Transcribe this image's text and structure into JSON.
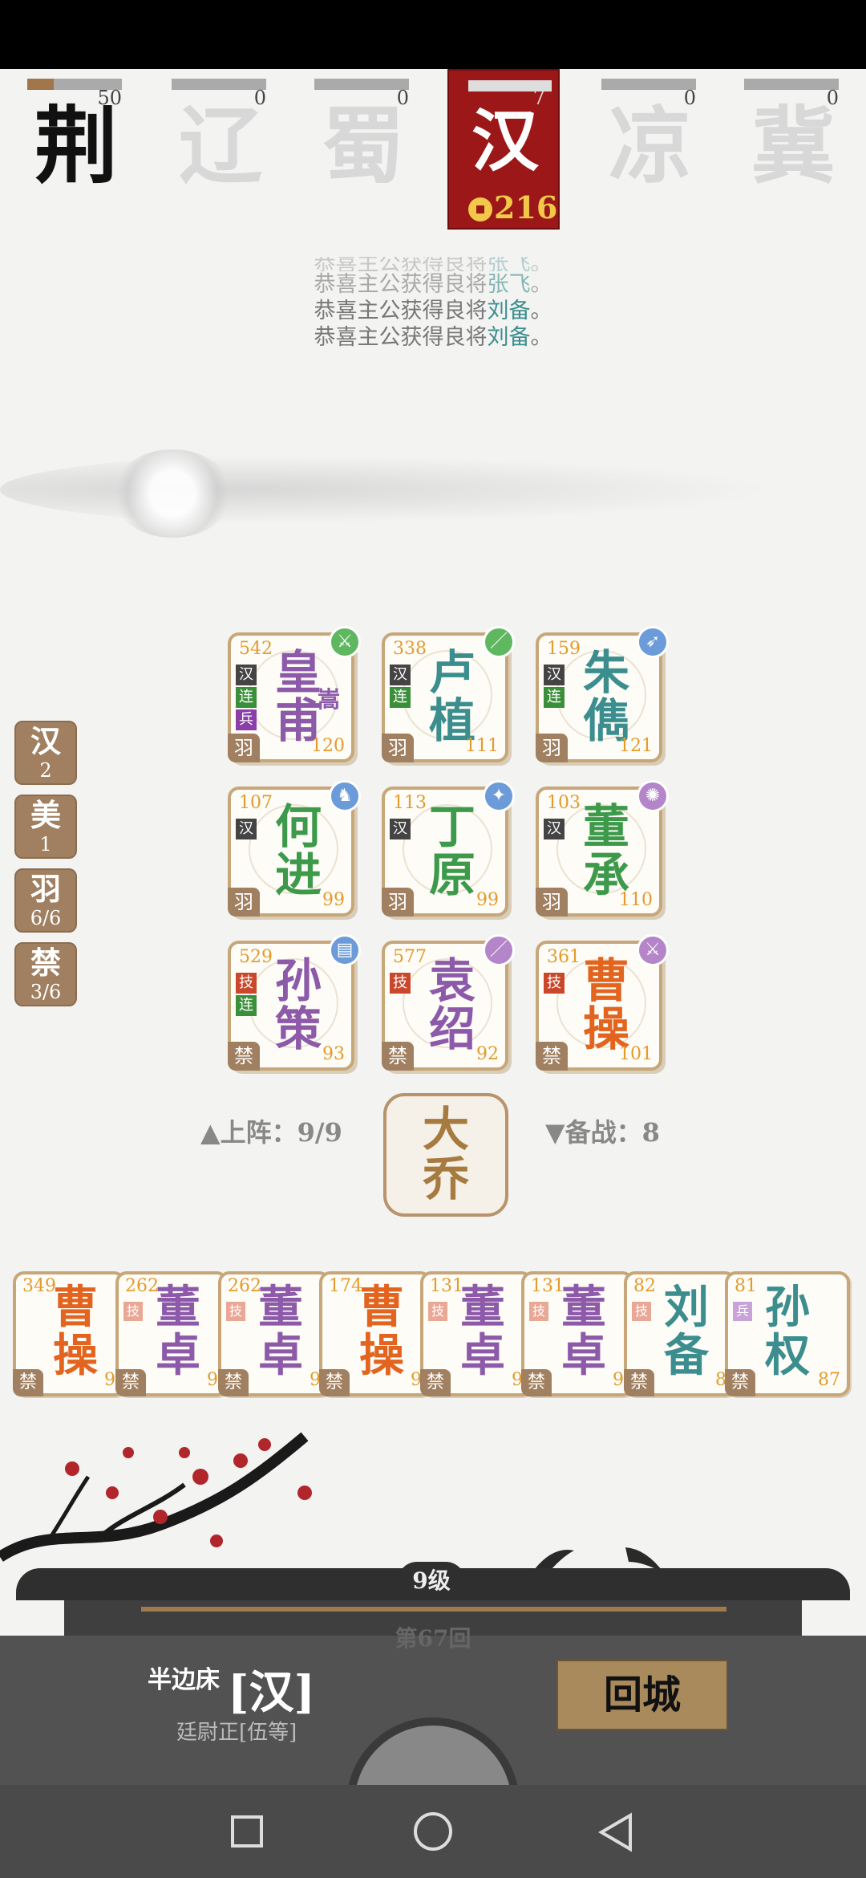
{
  "factions": [
    {
      "name": "荆",
      "count": "50",
      "progress": 0.28,
      "key": "jing"
    },
    {
      "name": "辽",
      "count": "0",
      "progress": 0,
      "key": "liao"
    },
    {
      "name": "蜀",
      "count": "0",
      "progress": 0,
      "key": "shu"
    },
    {
      "name": "汉",
      "count": "7",
      "progress": 0.05,
      "key": "han",
      "coins": "216"
    },
    {
      "name": "凉",
      "count": "0",
      "progress": 0,
      "key": "liang"
    },
    {
      "name": "冀",
      "count": "0",
      "progress": 0,
      "key": "ji"
    }
  ],
  "messages": [
    {
      "prefix": "恭喜主公获得良将",
      "hero": "张飞",
      "suffix": "。"
    },
    {
      "prefix": "恭喜主公获得良将",
      "hero": "张飞",
      "suffix": "。"
    },
    {
      "prefix": "恭喜主公获得良将",
      "hero": "刘备",
      "suffix": "。"
    },
    {
      "prefix": "恭喜主公获得良将",
      "hero": "刘备",
      "suffix": "。"
    }
  ],
  "side_tags": [
    {
      "t": "汉",
      "v": "2"
    },
    {
      "t": "美",
      "v": "1"
    },
    {
      "t": "羽",
      "v": "6/6"
    },
    {
      "t": "禁",
      "v": "3/6"
    }
  ],
  "board": [
    {
      "n1": "皇",
      "n2": "甫",
      "sub": "嵩",
      "top": "542",
      "br": "120",
      "corner": "羽",
      "tags": [
        "汉",
        "连",
        "兵"
      ],
      "badge": "sword",
      "color": "purple"
    },
    {
      "n1": "卢",
      "n2": "植",
      "top": "338",
      "br": "111",
      "corner": "羽",
      "tags": [
        "汉",
        "连"
      ],
      "badge": "spear",
      "color": "teal"
    },
    {
      "n1": "朱",
      "n2": "儁",
      "top": "159",
      "br": "121",
      "corner": "羽",
      "tags": [
        "汉",
        "连"
      ],
      "badge": "bow",
      "color": "teal"
    },
    {
      "n1": "何",
      "n2": "进",
      "top": "107",
      "br": "99",
      "corner": "羽",
      "tags": [
        "汉"
      ],
      "badge": "horse",
      "color": "green"
    },
    {
      "n1": "丁",
      "n2": "原",
      "top": "113",
      "br": "99",
      "corner": "羽",
      "tags": [
        "汉"
      ],
      "badge": "wand",
      "color": "green"
    },
    {
      "n1": "董",
      "n2": "承",
      "top": "103",
      "br": "110",
      "corner": "羽",
      "tags": [
        "汉"
      ],
      "badge": "beast",
      "color": "green"
    },
    {
      "n1": "孙",
      "n2": "策",
      "top": "529",
      "br": "93",
      "corner": "禁",
      "tags": [
        "技",
        "连"
      ],
      "badge": "book",
      "color": "purple"
    },
    {
      "n1": "袁",
      "n2": "绍",
      "top": "577",
      "br": "92",
      "corner": "禁",
      "tags": [
        "技"
      ],
      "badge": "spear",
      "color": "purple"
    },
    {
      "n1": "曹",
      "n2": "操",
      "top": "361",
      "br": "101",
      "corner": "禁",
      "tags": [
        "技"
      ],
      "badge": "sword",
      "color": "orange"
    }
  ],
  "formation_label": "▲上阵：9/9",
  "reserve_label": "▼备战：8",
  "center_hero": {
    "n1": "大",
    "n2": "乔"
  },
  "bench": [
    {
      "n1": "曹",
      "n2": "操",
      "top": "349",
      "br": "9",
      "corner": "禁",
      "tag": "",
      "color": "orange"
    },
    {
      "n1": "董",
      "n2": "卓",
      "top": "262",
      "br": "9",
      "corner": "禁",
      "tag": "技",
      "color": "purple"
    },
    {
      "n1": "董",
      "n2": "卓",
      "top": "262",
      "br": "9",
      "corner": "禁",
      "tag": "技",
      "color": "purple"
    },
    {
      "n1": "曹",
      "n2": "操",
      "top": "174",
      "br": "9",
      "corner": "禁",
      "tag": "",
      "color": "orange"
    },
    {
      "n1": "董",
      "n2": "卓",
      "top": "131",
      "br": "9",
      "corner": "禁",
      "tag": "技",
      "color": "purple"
    },
    {
      "n1": "董",
      "n2": "卓",
      "top": "131",
      "br": "9",
      "corner": "禁",
      "tag": "技",
      "color": "purple"
    },
    {
      "n1": "刘",
      "n2": "备",
      "top": "82",
      "br": "8",
      "corner": "禁",
      "tag": "技",
      "color": "teal"
    },
    {
      "n1": "孙",
      "n2": "权",
      "top": "81",
      "br": "87",
      "corner": "禁",
      "tag": "兵",
      "color": "teal"
    }
  ],
  "level": "9级",
  "round": "第67回",
  "player": {
    "name": "半边床",
    "faction": "[汉]",
    "rank": "廷尉正[伍等]"
  },
  "return_button": "回城",
  "colors": {
    "accent_red": "#9c1717",
    "gold": "#a88a5c",
    "purple": "#8d59a9",
    "teal": "#3c8e8e",
    "green": "#3e9a4b",
    "orange": "#e2641f"
  }
}
